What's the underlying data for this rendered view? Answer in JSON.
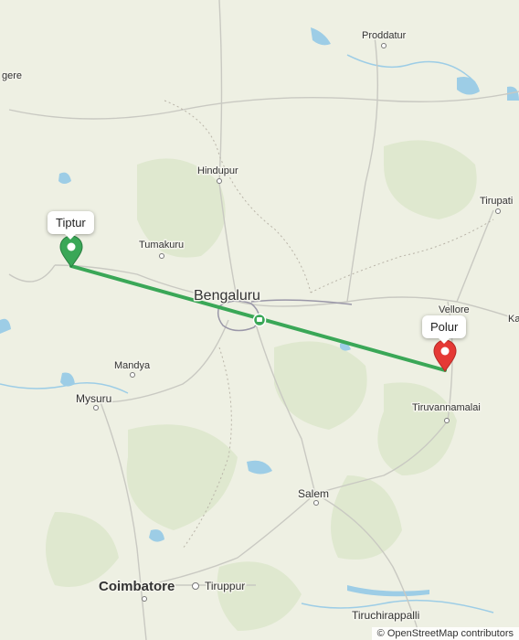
{
  "map": {
    "cities": [
      {
        "id": "gere",
        "label": "gere"
      },
      {
        "id": "proddatur",
        "label": "Proddatur"
      },
      {
        "id": "hindupur",
        "label": "Hindupur"
      },
      {
        "id": "tirupati",
        "label": "Tirupati"
      },
      {
        "id": "tumakuru",
        "label": "Tumakuru"
      },
      {
        "id": "bengaluru",
        "label": "Bengaluru"
      },
      {
        "id": "vellore",
        "label": "Vellore"
      },
      {
        "id": "ka",
        "label": "Ka"
      },
      {
        "id": "mandya",
        "label": "Mandya"
      },
      {
        "id": "mysuru",
        "label": "Mysuru"
      },
      {
        "id": "tiruvannamalai",
        "label": "Tiruvannamalai"
      },
      {
        "id": "salem",
        "label": "Salem"
      },
      {
        "id": "coimbatore",
        "label": "Coimbatore"
      },
      {
        "id": "tiruppur",
        "label": "Tiruppur"
      },
      {
        "id": "tiruchirappalli",
        "label": "Tiruchirappalli"
      }
    ],
    "route": {
      "start_label": "Tiptur",
      "end_label": "Polur",
      "route_color": "#3aa757",
      "start_color": "#3aa757",
      "end_color": "#e53935",
      "waypoint_icon": "train-station-icon"
    },
    "attribution": "© OpenStreetMap contributors",
    "colors": {
      "land": "#eef0e3",
      "forest": "#dfe8cf",
      "water": "#9dcde6",
      "road": "#c9c9c2"
    }
  }
}
